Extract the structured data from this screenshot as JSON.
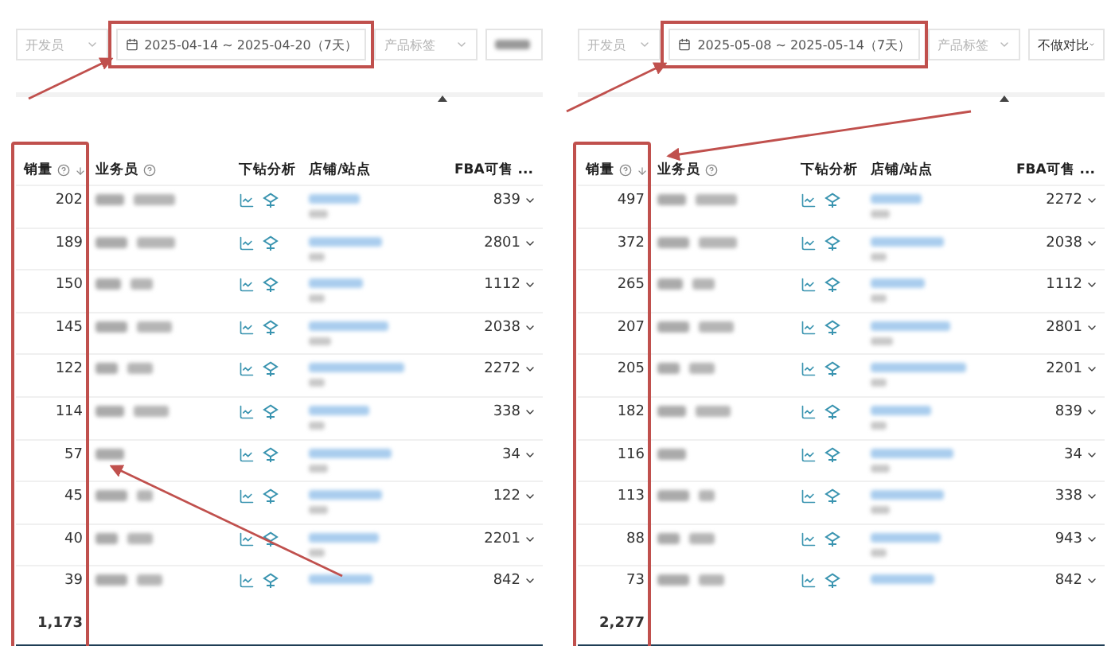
{
  "panels": [
    {
      "filters": [
        {
          "kind": "select",
          "placeholder": "开发员"
        },
        {
          "kind": "date",
          "value": "2025-04-14 ~ 2025-04-20（7天）",
          "highlighted": true
        },
        {
          "kind": "select",
          "placeholder": "产品标签"
        },
        {
          "kind": "redacted"
        }
      ],
      "columns": [
        {
          "label": "销量",
          "help": true,
          "sort": true,
          "highlighted": true
        },
        {
          "label": "业务员",
          "help": true
        },
        {
          "label": "下钻分析"
        },
        {
          "label": "店铺/站点"
        },
        {
          "label": "FBA可售 ..."
        }
      ],
      "rows": [
        {
          "sales": "202",
          "fba": "839"
        },
        {
          "sales": "189",
          "fba": "2801"
        },
        {
          "sales": "150",
          "fba": "1112"
        },
        {
          "sales": "145",
          "fba": "2038"
        },
        {
          "sales": "122",
          "fba": "2272"
        },
        {
          "sales": "114",
          "fba": "338"
        },
        {
          "sales": "57",
          "fba": "34"
        },
        {
          "sales": "45",
          "fba": "122"
        },
        {
          "sales": "40",
          "fba": "2201"
        },
        {
          "sales": "39",
          "fba": "842"
        }
      ],
      "total": "1,173"
    },
    {
      "filters": [
        {
          "kind": "select",
          "placeholder": "开发员"
        },
        {
          "kind": "date",
          "value": "2025-05-08 ~ 2025-05-14（7天）",
          "highlighted": true
        },
        {
          "kind": "select",
          "placeholder": "产品标签"
        },
        {
          "kind": "value-select",
          "value": "不做对比"
        }
      ],
      "columns": [
        {
          "label": "销量",
          "help": true,
          "sort": true,
          "highlighted": true
        },
        {
          "label": "业务员",
          "help": true
        },
        {
          "label": "下钻分析"
        },
        {
          "label": "店铺/站点"
        },
        {
          "label": "FBA可售 ..."
        }
      ],
      "rows": [
        {
          "sales": "497",
          "fba": "2272"
        },
        {
          "sales": "372",
          "fba": "2038"
        },
        {
          "sales": "265",
          "fba": "1112"
        },
        {
          "sales": "207",
          "fba": "2801"
        },
        {
          "sales": "205",
          "fba": "2201"
        },
        {
          "sales": "182",
          "fba": "839"
        },
        {
          "sales": "116",
          "fba": "34"
        },
        {
          "sales": "113",
          "fba": "338"
        },
        {
          "sales": "88",
          "fba": "943"
        },
        {
          "sales": "73",
          "fba": "842"
        }
      ],
      "total": "2,277"
    }
  ]
}
